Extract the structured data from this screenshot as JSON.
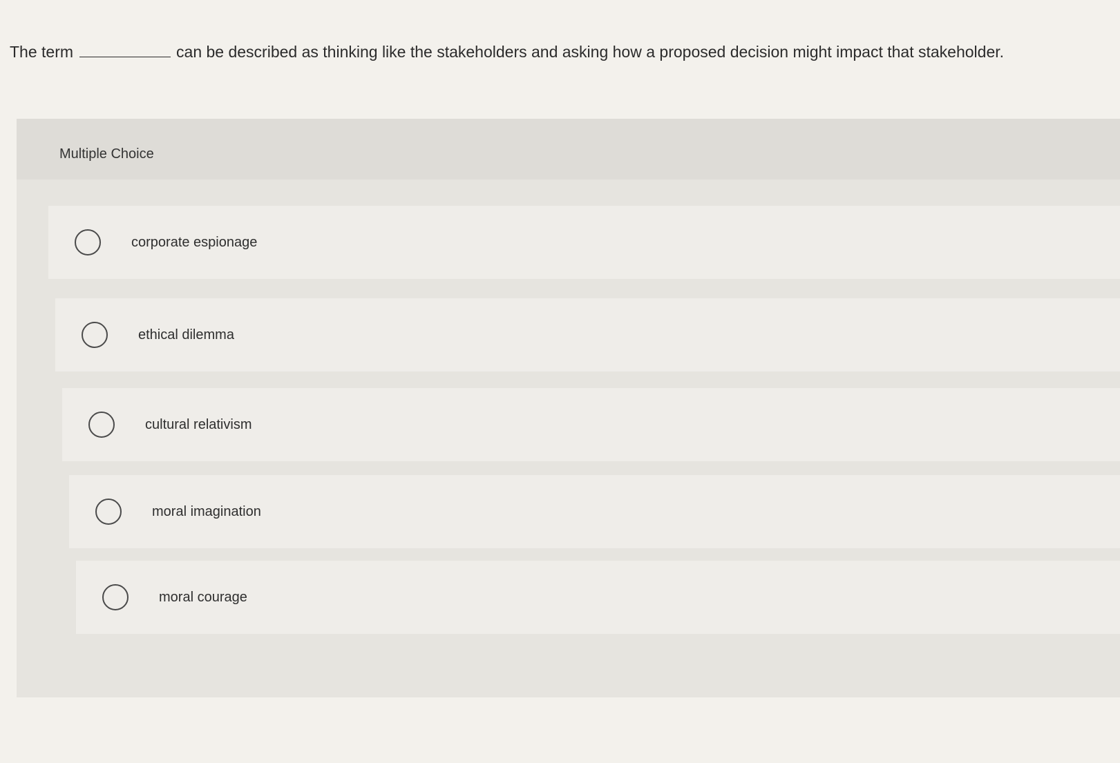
{
  "question": {
    "prefix": "The term",
    "suffix": "can be described as thinking like the stakeholders and asking how a proposed decision might impact that stakeholder."
  },
  "multiple_choice": {
    "label": "Multiple Choice",
    "options": [
      {
        "label": "corporate espionage",
        "selected": false
      },
      {
        "label": "ethical dilemma",
        "selected": false
      },
      {
        "label": "cultural relativism",
        "selected": false
      },
      {
        "label": "moral imagination",
        "selected": false
      },
      {
        "label": "moral courage",
        "selected": false
      }
    ]
  }
}
